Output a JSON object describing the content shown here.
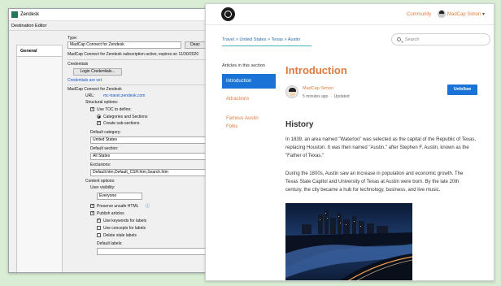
{
  "editor": {
    "app_title": "Zendesk",
    "window_subtitle": "Destination Editor",
    "tab_general": "General",
    "type_label": "Type:",
    "type_value": "MadCap Connect for Zendesk",
    "deactivate_label": "Deac",
    "subscription_text": "MadCap Connect for Zendesk subscription active; expires on 11/30/2020",
    "credentials_label": "Credentials",
    "login_button": "Login Credentials...",
    "credentials_status": "Credentials are set",
    "section_title": "MadCap Connect for Zendesk",
    "url_label": "URL:",
    "url_value": "mc-travel.zendesk.com",
    "structural_label": "Structural options:",
    "use_toc": "Use TOC to define:",
    "categories_sections": "Categories and Sections",
    "create_subsections": "Create sub-sections",
    "default_category_label": "Default category:",
    "default_category_value": "United States",
    "default_section_label": "Default section:",
    "default_section_value": "All States",
    "exclusions_label": "Exclusions:",
    "exclusions_value": "Default.htm,Default_CSH.htm,Search.htm",
    "content_options_label": "Content options:",
    "user_visibility_label": "User visibility:",
    "user_visibility_value": "Everyone",
    "preserve_html": "Preserve unsafe HTML",
    "publish_articles": "Publish articles",
    "use_keywords": "Use keywords for labels",
    "use_concepts": "Use concepts for labels",
    "delete_stale": "Delete stale labels",
    "default_labels_label": "Default labels:"
  },
  "site": {
    "community": "Community",
    "user_name": "MadCap Simon",
    "caret": "▾",
    "breadcrumb": "Travel > United States > Texas > Austin",
    "search_placeholder": "Search",
    "side_heading": "Articles in this section",
    "side_items": [
      "Introduction",
      "Attractions",
      "Famous Austin Folks"
    ],
    "article_title": "Introduction",
    "author": "MadCap Simon",
    "meta_time": "5 minutes ago",
    "meta_updated": "Updated",
    "unfollow": "Unfollow",
    "history_heading": "History",
    "para1": "In 1839, an area named \"Waterloo\" was selected as the capital of the Republic of Texas, replacing Houston. It was then named \"Austin,\" after Stephen F. Austin, known as the \"Father of Texas.\"",
    "para2": "During the 1800s, Austin saw an increase in population and economic growth. The Texas State Capitol and University of Texas at Austin were born. By the late 20th century, the city became a hub for technology, business, and live music."
  },
  "colors": {
    "accent_orange": "#e07a3b",
    "button_blue": "#1a73d6",
    "background_green": "#d9ecd4"
  }
}
